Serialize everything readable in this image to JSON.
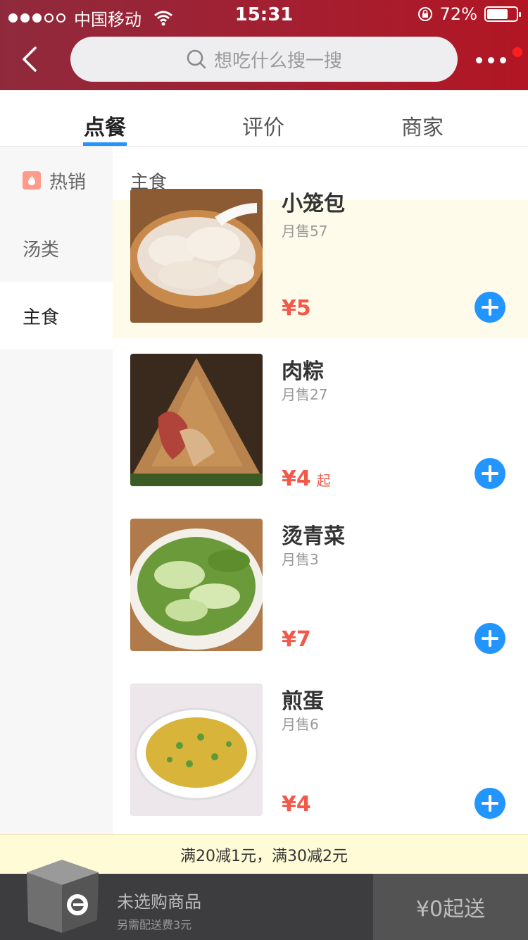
{
  "status": {
    "carrier": "中国移动",
    "time": "15:31",
    "battery": "72%",
    "battery_level": 0.72
  },
  "search": {
    "placeholder": "想吃什么搜一搜"
  },
  "tabs": [
    {
      "label": "点餐",
      "active": true
    },
    {
      "label": "评价",
      "active": false
    },
    {
      "label": "商家",
      "active": false
    }
  ],
  "sidebar": {
    "items": [
      {
        "label": "热销",
        "icon": "flame-icon"
      },
      {
        "label": "汤类"
      },
      {
        "label": "主食",
        "active": true
      }
    ]
  },
  "category_title": "主食",
  "items": [
    {
      "name": "小笼包",
      "sales": "月售57",
      "price": "¥5",
      "suffix": ""
    },
    {
      "name": "肉粽",
      "sales": "月售27",
      "price": "¥4",
      "suffix": "起"
    },
    {
      "name": "烫青菜",
      "sales": "月售3",
      "price": "¥7",
      "suffix": ""
    },
    {
      "name": "煎蛋",
      "sales": "月售6",
      "price": "¥4",
      "suffix": ""
    }
  ],
  "promo": "满20减1元，满30减2元",
  "cart": {
    "title": "未选购商品",
    "subtitle": "另需配送费3元",
    "checkout": "¥0起送"
  },
  "colors": {
    "header": "#a31f31",
    "accent": "#2395ff",
    "price": "#f1594a",
    "highlight_row": "#fffbea"
  }
}
